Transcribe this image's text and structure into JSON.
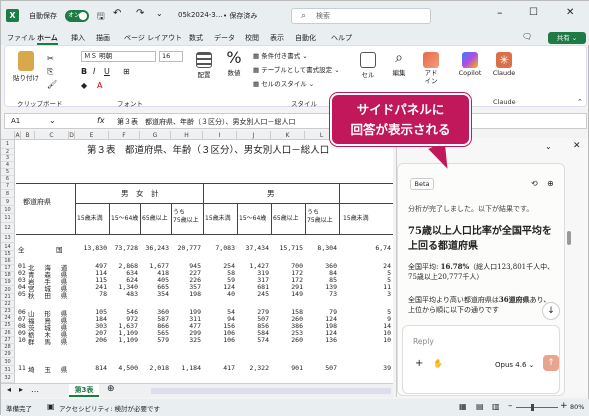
{
  "titlebar": {
    "autosave_label": "自動保存",
    "autosave_state": "オン",
    "filename": "05k2024-3…",
    "save_status": "• 保存済み",
    "search_placeholder": "検索"
  },
  "menu": [
    "ファイル",
    "ホーム",
    "挿入",
    "描画",
    "ページ レイアウト",
    "数式",
    "データ",
    "校閲",
    "表示",
    "自動化",
    "ヘルプ"
  ],
  "share_label": "共有",
  "ribbon": {
    "paste": "貼り付け",
    "clipboard_group": "クリップボード",
    "font_name": "ＭＳ 明朝",
    "font_size": "16",
    "font_group": "フォント",
    "align": "配置",
    "number": "数値",
    "cond_format": "条件付き書式",
    "table_format": "テーブルとして書式設定",
    "cell_style": "セルのスタイル",
    "style_group": "スタイル",
    "cell": "セル",
    "edit": "編集",
    "addin": "アド\nイン",
    "copilot": "Copilot",
    "claude": "Claude",
    "claude_group": "Claude"
  },
  "formula_bar": {
    "name_box": "A1",
    "fx": "fx",
    "formula": "第３表　都道府県、年齢（３区分）、男女別人口－総人口"
  },
  "columns": [
    "A",
    "B",
    "C",
    "D",
    "E",
    "F",
    "G",
    "H",
    "I",
    "J",
    "K",
    "L"
  ],
  "sheet": {
    "title": "第３表　都道府県、年齢（３区分）、男女別人口－総人口",
    "row_numbers": [
      "1",
      "2",
      "3",
      "4",
      "5",
      "6",
      "7",
      "8",
      "9",
      "10",
      "11",
      "12",
      "13",
      "14",
      "15",
      "16",
      "17",
      "18",
      "19",
      "20",
      "21",
      "22",
      "23",
      "24",
      "25",
      "26",
      "27",
      "28",
      "29",
      "30",
      "31",
      "32"
    ],
    "header_pref": "都道府県",
    "header_total": "男　女　計",
    "header_male": "男",
    "sub_headers": [
      "15歳未満",
      "15～64歳",
      "65歳以上",
      "うち\n75歳以上",
      "15歳未満",
      "15～64歳",
      "65歳以上",
      "うち\n75歳以上",
      "15歳未満"
    ],
    "rows": [
      {
        "code": "",
        "name": "全　　　国",
        "vals": [
          "13,830",
          "73,728",
          "36,243",
          "20,777",
          "7,083",
          "37,434",
          "15,715",
          "8,304",
          "6,74"
        ]
      },
      {
        "code": "01",
        "name": "北 海 道",
        "vals": [
          "497",
          "2,868",
          "1,677",
          "945",
          "254",
          "1,427",
          "700",
          "360",
          "24"
        ]
      },
      {
        "code": "02",
        "name": "青 森 県",
        "vals": [
          "114",
          "634",
          "418",
          "227",
          "58",
          "319",
          "172",
          "84",
          "5"
        ]
      },
      {
        "code": "03",
        "name": "岩 手 県",
        "vals": [
          "115",
          "624",
          "405",
          "226",
          "59",
          "317",
          "172",
          "85",
          "5"
        ]
      },
      {
        "code": "04",
        "name": "宮 城 県",
        "vals": [
          "241",
          "1,340",
          "665",
          "357",
          "124",
          "681",
          "291",
          "139",
          "11"
        ]
      },
      {
        "code": "05",
        "name": "秋 田 県",
        "vals": [
          "78",
          "483",
          "354",
          "198",
          "40",
          "245",
          "149",
          "73",
          "3"
        ]
      },
      {
        "code": "06",
        "name": "山 形 県",
        "vals": [
          "105",
          "546",
          "360",
          "199",
          "54",
          "279",
          "158",
          "79",
          "5"
        ]
      },
      {
        "code": "07",
        "name": "福 島 県",
        "vals": [
          "184",
          "972",
          "587",
          "311",
          "94",
          "507",
          "260",
          "124",
          "9"
        ]
      },
      {
        "code": "08",
        "name": "茨 城 県",
        "vals": [
          "303",
          "1,637",
          "866",
          "477",
          "156",
          "856",
          "386",
          "198",
          "14"
        ]
      },
      {
        "code": "09",
        "name": "栃 木 県",
        "vals": [
          "207",
          "1,109",
          "565",
          "299",
          "106",
          "584",
          "253",
          "124",
          "10"
        ]
      },
      {
        "code": "10",
        "name": "群 馬 県",
        "vals": [
          "206",
          "1,109",
          "579",
          "325",
          "106",
          "574",
          "260",
          "136",
          "10"
        ]
      },
      {
        "code": "11",
        "name": "埼 玉 県",
        "vals": [
          "814",
          "4,500",
          "2,018",
          "1,184",
          "417",
          "2,322",
          "901",
          "507",
          "39"
        ]
      }
    ],
    "sheet_tab": "第3表"
  },
  "status": {
    "ready": "準備完了",
    "accessibility": "アクセシビリティ: 検討が必要です",
    "zoom": "80%"
  },
  "side_panel": {
    "beta": "Beta",
    "intro": "分析が完了しました。以下が結果です。",
    "heading": "75歳以上人口比率が全国平均を上回る都道府県",
    "stat_label": "全国平均:",
    "stat_value": "16.78%",
    "stat_detail": "（総人口123,801千人中、75歳以上20,777千人）",
    "p2a": "全国平均より高い都道府県は",
    "p2b": "36道府県",
    "p2c": "あり、上位から順に以下の通りです",
    "reply_placeholder": "Reply",
    "model": "Opus 4.6 ⌄"
  },
  "callout": {
    "line1": "サイドパネルに",
    "line2": "回答が表示される"
  }
}
